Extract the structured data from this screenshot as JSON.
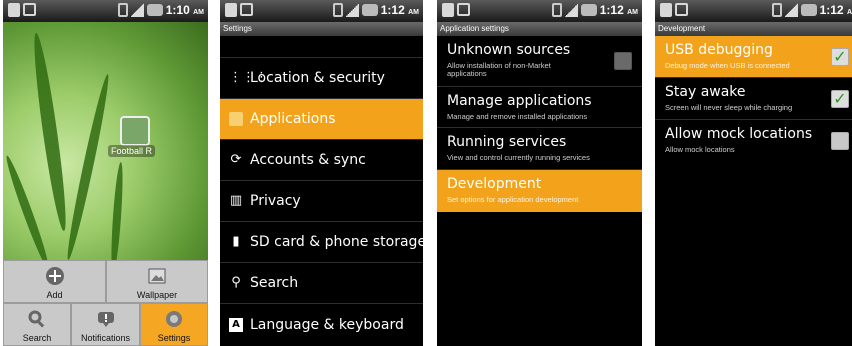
{
  "screens": {
    "home": {
      "status_time": "1:10",
      "status_ampm": "AM",
      "app_label": "Football R",
      "menu": [
        {
          "label": "Add",
          "icon": "plus-icon"
        },
        {
          "label": "Wallpaper",
          "icon": "picture-icon"
        },
        {
          "label": "Search",
          "icon": "search-icon"
        },
        {
          "label": "Notifications",
          "icon": "notification-icon"
        },
        {
          "label": "Settings",
          "icon": "gear-icon",
          "selected": true
        }
      ]
    },
    "settings": {
      "status_time": "1:12",
      "status_ampm": "AM",
      "title": "Settings",
      "items": [
        {
          "label": "Location & security",
          "icon": "grid-icon"
        },
        {
          "label": "Applications",
          "icon": "app-icon",
          "selected": true
        },
        {
          "label": "Accounts & sync",
          "icon": "sync-icon"
        },
        {
          "label": "Privacy",
          "icon": "privacy-icon"
        },
        {
          "label": "SD card & phone storage",
          "icon": "sdcard-icon"
        },
        {
          "label": "Search",
          "icon": "search-icon"
        },
        {
          "label": "Language & keyboard",
          "icon": "keyboard-icon"
        }
      ]
    },
    "app_settings": {
      "status_time": "1:12",
      "status_ampm": "AM",
      "title": "Application settings",
      "items": [
        {
          "title": "Unknown sources",
          "subtitle": "Allow installation of non-Market",
          "subtitle2": "applications",
          "checkbox": "disabled"
        },
        {
          "title": "Manage applications",
          "subtitle": "Manage and remove installed applications"
        },
        {
          "title": "Running services",
          "subtitle": "View and control currently running services"
        },
        {
          "title": "Development",
          "subtitle": "Set options for application development",
          "selected": true
        }
      ]
    },
    "development": {
      "status_time": "1:12",
      "status_ampm": "A",
      "title": "Development",
      "items": [
        {
          "title": "USB debugging",
          "subtitle": "Debug mode when USB is connected",
          "checked": true,
          "selected": true
        },
        {
          "title": "Stay awake",
          "subtitle": "Screen will never sleep while charging",
          "checked": true
        },
        {
          "title": "Allow mock locations",
          "subtitle": "Allow mock locations",
          "checked": false
        }
      ]
    }
  },
  "colors": {
    "highlight": "#f3a31b",
    "check_green": "#2c9b1d"
  }
}
